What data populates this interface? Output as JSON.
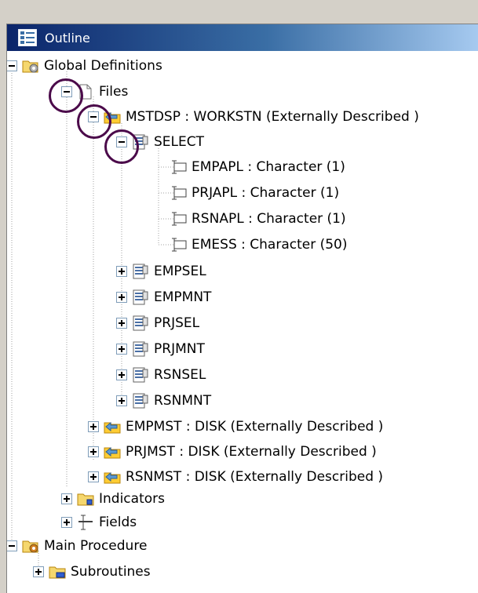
{
  "outline": {
    "title": "Outline",
    "title_icon": "outline-icon",
    "nodes": {
      "global_definitions": "Global Definitions",
      "files": "Files",
      "mstdsp": "MSTDSP : WORKSTN (Externally Described )",
      "select": "SELECT",
      "empapl": "EMPAPL : Character (1)",
      "prjapl": "PRJAPL : Character (1)",
      "rsnapl": "RSNAPL : Character (1)",
      "emess": "EMESS : Character (50)",
      "empsel": "EMPSEL",
      "empmnt": "EMPMNT",
      "prjsel": "PRJSEL",
      "prjmnt": "PRJMNT",
      "rsnsel": "RSNSEL",
      "rsnmnt": "RSNMNT",
      "empmst": "EMPMST : DISK (Externally Described )",
      "prjmst": "PRJMST : DISK (Externally Described )",
      "rsnmst": "RSNMST : DISK (Externally Described )",
      "indicators": "Indicators",
      "fields": "Fields",
      "main_procedure": "Main Procedure",
      "subroutines": "Subroutines"
    }
  },
  "colors": {
    "titlebar_start": "#0a246a",
    "titlebar_end": "#a6caf0",
    "highlight_circle": "#4b0a4a",
    "folder": "#f5d76e",
    "display_file": "#ffcc33"
  }
}
